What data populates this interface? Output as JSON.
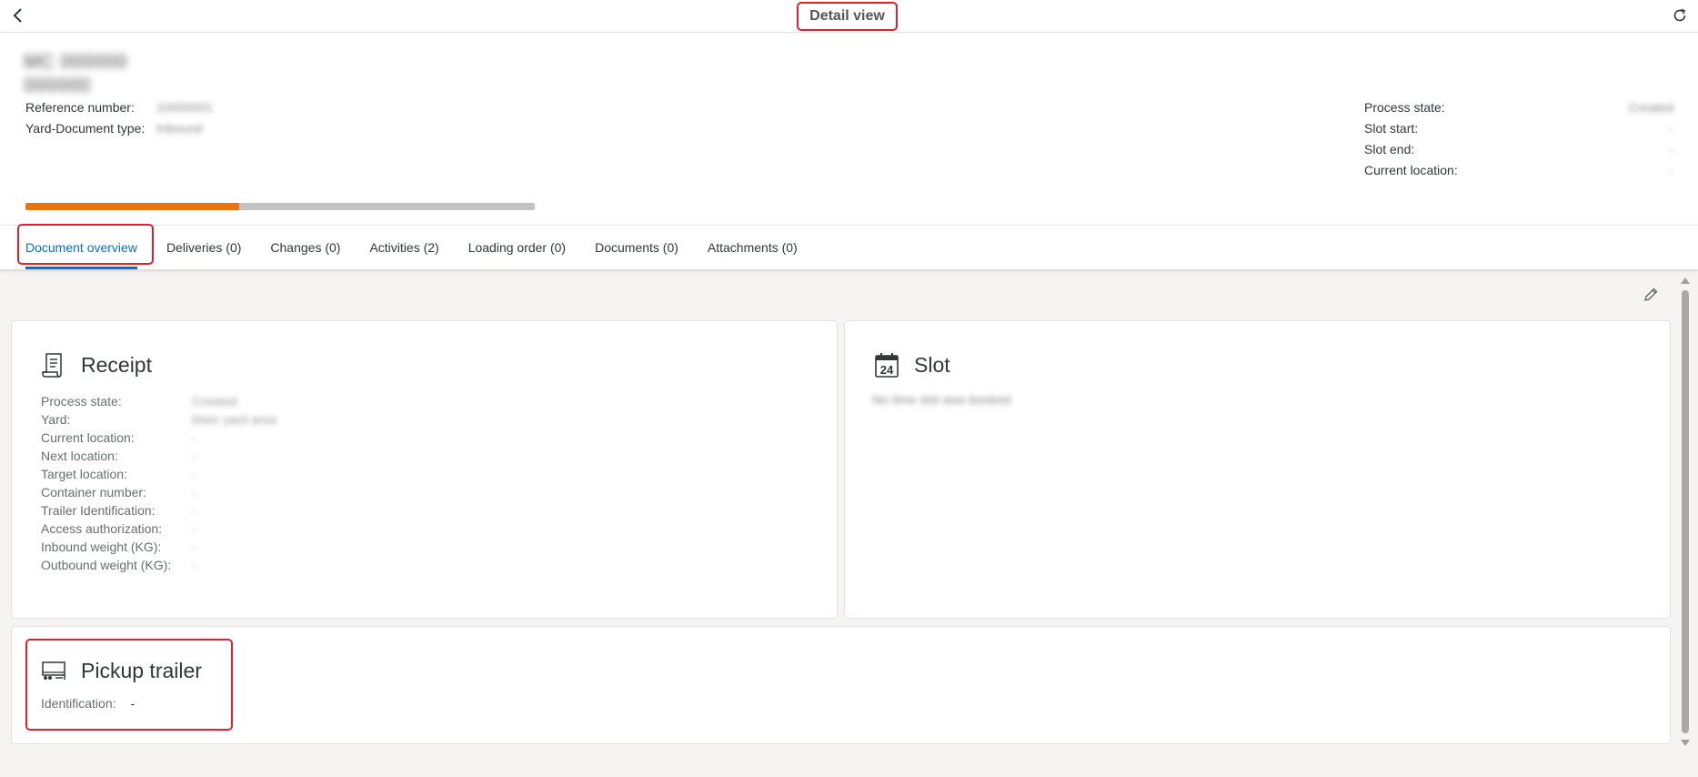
{
  "shellbar": {
    "title": "Detail view"
  },
  "header": {
    "object_title": "MC 000000 000000",
    "left_attributes": [
      {
        "label": "Reference number:",
        "value": "10000001"
      },
      {
        "label": "Yard-Document type:",
        "value": "Inbound"
      }
    ],
    "right_attributes": [
      {
        "label": "Process state:",
        "value": "Created"
      },
      {
        "label": "Slot start:",
        "value": "-"
      },
      {
        "label": "Slot end:",
        "value": "-"
      },
      {
        "label": "Current location:",
        "value": "-"
      }
    ],
    "progress_fraction": 0.42,
    "colors": {
      "progress": "#e9730c",
      "progress_track": "#c3c3c3"
    }
  },
  "tabs": [
    {
      "label": "Document overview",
      "active": true
    },
    {
      "label": "Deliveries (0)"
    },
    {
      "label": "Changes (0)"
    },
    {
      "label": "Activities (2)"
    },
    {
      "label": "Loading order (0)"
    },
    {
      "label": "Documents (0)"
    },
    {
      "label": "Attachments (0)"
    }
  ],
  "receipt": {
    "title": "Receipt",
    "icon": "receipt-icon",
    "fields": [
      {
        "label": "Process state:",
        "value": "Created"
      },
      {
        "label": "Yard:",
        "value": "Main yard area"
      },
      {
        "label": "Current location:",
        "value": "-"
      },
      {
        "label": "Next location:",
        "value": "-"
      },
      {
        "label": "Target location:",
        "value": "-"
      },
      {
        "label": "Container number:",
        "value": "-"
      },
      {
        "label": "Trailer Identification:",
        "value": "-"
      },
      {
        "label": "Access authorization:",
        "value": "-"
      },
      {
        "label": "Inbound weight (KG):",
        "value": "-"
      },
      {
        "label": "Outbound weight (KG):",
        "value": "-"
      }
    ]
  },
  "slot": {
    "title": "Slot",
    "icon": "calendar-icon",
    "calendar_day": "24",
    "message": "No time slot was booked"
  },
  "pickup": {
    "title": "Pickup trailer",
    "icon": "trailer-icon",
    "identification_label": "Identification:",
    "identification_value": "-"
  }
}
